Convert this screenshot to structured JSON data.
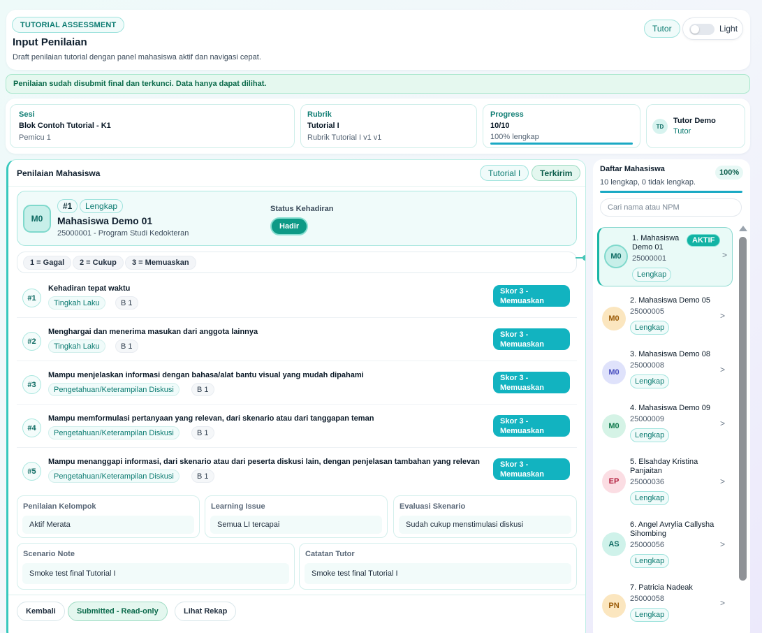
{
  "header": {
    "tag": "TUTORIAL ASSESSMENT",
    "title": "Input Penilaian",
    "subtitle": "Draft penilaian tutorial dengan panel mahasiswa aktif dan navigasi cepat.",
    "role": "Tutor",
    "theme_label": "Light"
  },
  "alert": {
    "text": "Penilaian sudah disubmit final dan terkunci. Data hanya dapat dilihat."
  },
  "info": {
    "sesi": {
      "label": "Sesi",
      "main": "Blok Contoh Tutorial - K1",
      "sub": "Pemicu 1"
    },
    "rubrik": {
      "label": "Rubrik",
      "main": "Tutorial I",
      "sub": "Rubrik Tutorial I v1 v1"
    },
    "progress": {
      "label": "Progress",
      "main": "10/10",
      "sub": "100% lengkap",
      "fraction": 1.0
    },
    "tutor": {
      "initials": "TD",
      "name": "Tutor Demo",
      "role": "Tutor"
    }
  },
  "panel": {
    "title": "Penilaian Mahasiswa",
    "chip_tutorial": "Tutorial I",
    "chip_status": "Terkirim"
  },
  "student": {
    "initials": "M0",
    "number": "#1",
    "status": "Lengkap",
    "name": "Mahasiswa Demo 01",
    "info": "25000001 - Program Studi Kedokteran",
    "attendance_label": "Status Kehadiran",
    "attendance_value": "Hadir"
  },
  "legend": [
    "1 = Gagal",
    "2 = Cukup",
    "3 = Memuaskan"
  ],
  "criteria": [
    {
      "num": "#1",
      "title": "Kehadiran tepat waktu",
      "category": "Tingkah Laku",
      "weight": "B 1",
      "score_line1": "Skor 3 -",
      "score_line2": "Memuaskan"
    },
    {
      "num": "#2",
      "title": "Menghargai dan menerima masukan dari anggota lainnya",
      "category": "Tingkah Laku",
      "weight": "B 1",
      "score_line1": "Skor 3 -",
      "score_line2": "Memuaskan"
    },
    {
      "num": "#3",
      "title": "Mampu menjelaskan informasi dengan bahasa/alat bantu visual yang mudah dipahami",
      "category": "Pengetahuan/Keterampilan Diskusi",
      "weight": "B 1",
      "score_line1": "Skor 3 -",
      "score_line2": "Memuaskan"
    },
    {
      "num": "#4",
      "title": "Mampu memformulasi pertanyaan yang relevan, dari skenario atau dari tanggapan teman",
      "category": "Pengetahuan/Keterampilan Diskusi",
      "weight": "B 1",
      "score_line1": "Skor 3 -",
      "score_line2": "Memuaskan"
    },
    {
      "num": "#5",
      "title": "Mampu menanggapi informasi, dari skenario atau dari peserta diskusi lain, dengan penjelasan tambahan yang relevan",
      "category": "Pengetahuan/Keterampilan Diskusi",
      "weight": "B 1",
      "score_line1": "Skor 3 -",
      "score_line2": "Memuaskan"
    }
  ],
  "fields": {
    "kelompok": {
      "label": "Penilaian Kelompok",
      "value": "Aktif Merata"
    },
    "learning": {
      "label": "Learning Issue",
      "value": "Semua LI tercapai"
    },
    "evaluasi": {
      "label": "Evaluasi Skenario",
      "value": "Sudah cukup menstimulasi diskusi"
    },
    "scenario_note": {
      "label": "Scenario Note",
      "value": "Smoke test final Tutorial I"
    },
    "catatan": {
      "label": "Catatan Tutor",
      "value": "Smoke test final Tutorial I"
    }
  },
  "footer": {
    "back": "Kembali",
    "submitted": "Submitted - Read-only",
    "recap": "Lihat Rekap"
  },
  "student_list": {
    "title": "Daftar Mahasiswa",
    "percent": "100%",
    "summary": "10 lengkap, 0 tidak lengkap.",
    "search_placeholder": "Cari nama atau NPM",
    "active_label": "AKTIF",
    "items": [
      {
        "initials": "M0",
        "name": "1. Mahasiswa Demo 01",
        "npm": "25000001",
        "status": "Lengkap",
        "active": true,
        "color": "#c7efe9",
        "text_color": "#0d6a62"
      },
      {
        "initials": "M0",
        "name": "2. Mahasiswa Demo 05",
        "npm": "25000005",
        "status": "Lengkap",
        "color": "#fbe6bf",
        "text_color": "#9a5a06"
      },
      {
        "initials": "M0",
        "name": "3. Mahasiswa Demo 08",
        "npm": "25000008",
        "status": "Lengkap",
        "color": "#dfe2fb",
        "text_color": "#4a4fc0"
      },
      {
        "initials": "M0",
        "name": "4. Mahasiswa Demo 09",
        "npm": "25000009",
        "status": "Lengkap",
        "color": "#d5f3e6",
        "text_color": "#127a4e"
      },
      {
        "initials": "EP",
        "name": "5. Elsahday Kristina Panjaitan",
        "npm": "25000036",
        "status": "Lengkap",
        "color": "#fbdde3",
        "text_color": "#b01838"
      },
      {
        "initials": "AS",
        "name": "6. Angel Avrylia Callysha Sihombing",
        "npm": "25000056",
        "status": "Lengkap",
        "color": "#cff2ea",
        "text_color": "#0d6a62"
      },
      {
        "initials": "PN",
        "name": "7. Patricia Nadeak",
        "npm": "25000058",
        "status": "Lengkap",
        "color": "#fbe6bf",
        "text_color": "#9a5a06"
      }
    ]
  },
  "icons": {
    "chevron": "chevron-right-icon",
    "scroll_up": "triangle-up-icon"
  },
  "colors": {
    "accent": "#12b3c0",
    "brand": "#0e9a86",
    "success_bg": "#e5f8ef"
  }
}
